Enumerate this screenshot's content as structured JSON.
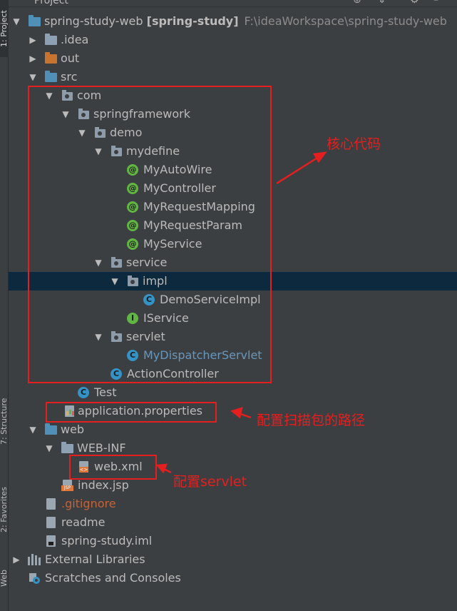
{
  "header": {
    "title": "Project"
  },
  "stripe": {
    "project_tab": "1: Project",
    "structure_tab": "7: Structure",
    "favorites_tab": "2: Favorites",
    "web_tab": "Web"
  },
  "tree": {
    "root": {
      "name": "spring-study-web",
      "module": "[spring-study]",
      "path": "F:\\ideaWorkspace\\spring-study-web"
    },
    "idea": ".idea",
    "out": "out",
    "src": "src",
    "com": "com",
    "springframework": "springframework",
    "demo": "demo",
    "mydefine": "mydefine",
    "my_auto_wire": "MyAutoWire",
    "my_controller": "MyController",
    "my_request_mapping": "MyRequestMapping",
    "my_request_param": "MyRequestParam",
    "my_service": "MyService",
    "service": "service",
    "impl": "impl",
    "demo_service_impl": "DemoServiceImpl",
    "iservice": "IService",
    "servlet": "servlet",
    "my_dispatcher_servlet": "MyDispatcherServlet",
    "action_controller": "ActionController",
    "test": "Test",
    "application_properties": "application.properties",
    "web": "web",
    "web_inf": "WEB-INF",
    "web_xml": "web.xml",
    "index_jsp": "index.jsp",
    "gitignore": ".gitignore",
    "readme": "readme",
    "iml": "spring-study.iml",
    "external_libraries": "External Libraries",
    "scratches": "Scratches and Consoles"
  },
  "annotations": {
    "core_code": "核心代码",
    "config_scan_path": "配置扫描包的路径",
    "config_servlet": "配置servlet"
  },
  "colors": {
    "annotation": "#e51f1f",
    "selected_row": "#0d293e",
    "tree_bg": "#3c3f41"
  }
}
